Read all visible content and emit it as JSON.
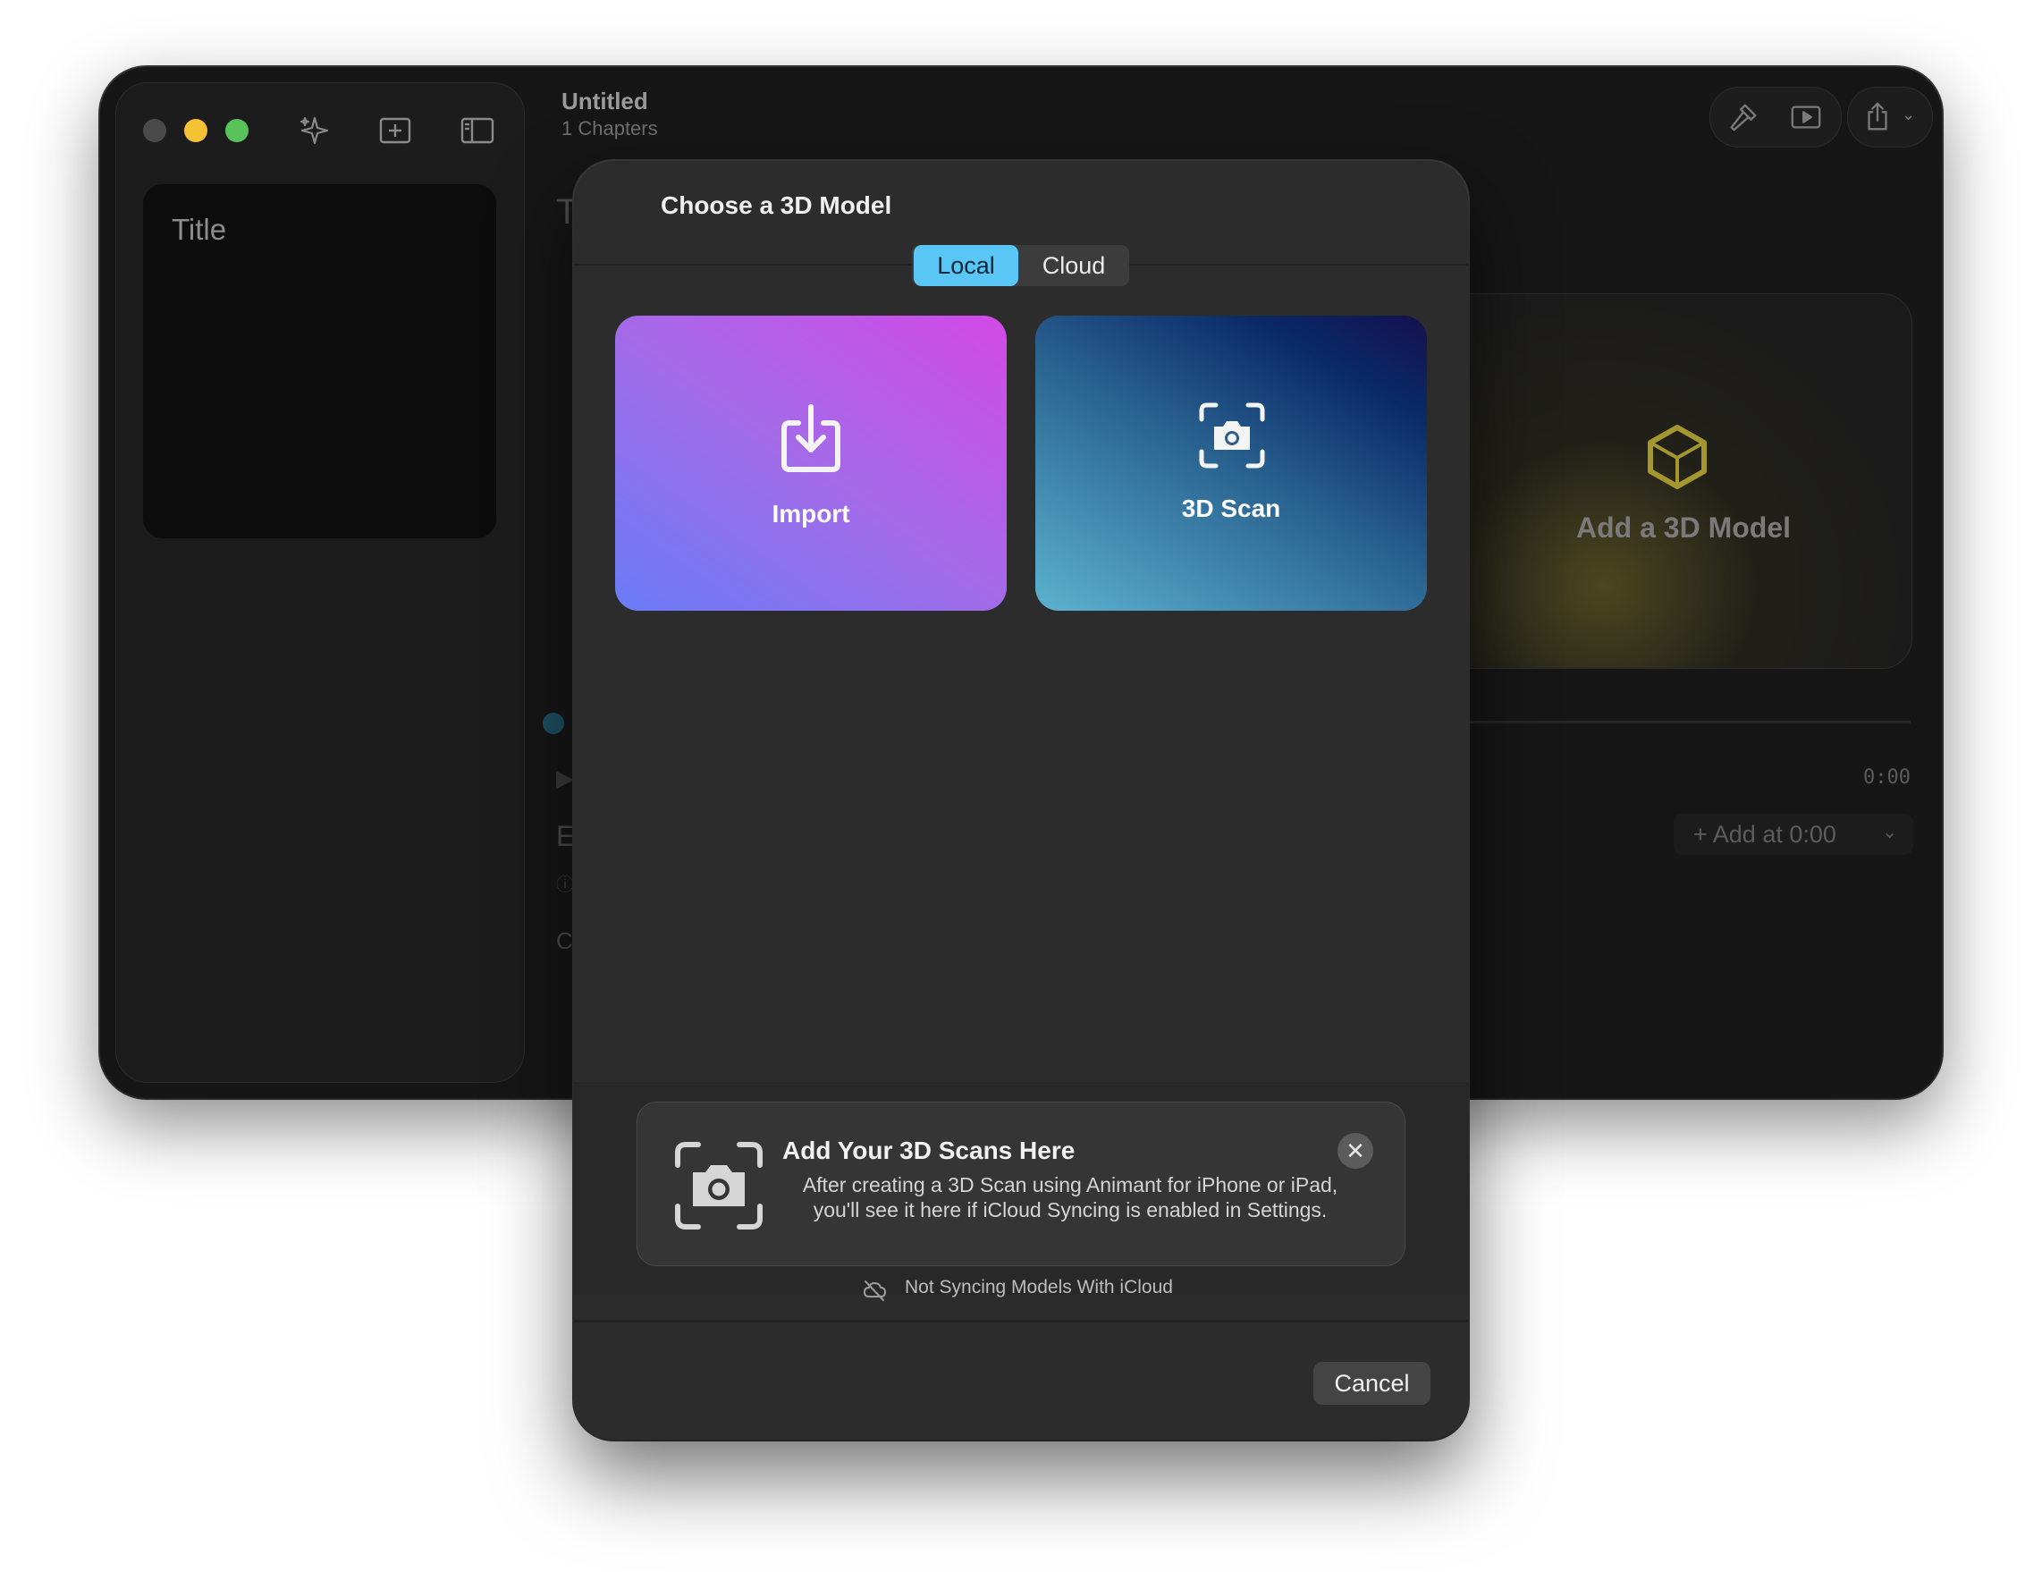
{
  "window": {
    "doc_title": "Untitled",
    "doc_subtitle": "1 Chapters",
    "sidebar_title_card": "Title",
    "bg_partial_letters": [
      "T",
      "E",
      "C"
    ],
    "add_model_card_label": "Add a 3D Model",
    "timeline_time": "0:00",
    "add_at_button": "+ Add at 0:00",
    "add_at_chevron": "⌄"
  },
  "modal": {
    "title": "Choose a 3D Model",
    "tabs": [
      {
        "label": "Local",
        "selected": true
      },
      {
        "label": "Cloud",
        "selected": false
      }
    ],
    "tiles": [
      {
        "label": "Import",
        "icon": "download-tray-icon"
      },
      {
        "label": "3D Scan",
        "icon": "camera-scan-icon"
      }
    ],
    "info_box": {
      "title": "Add Your 3D Scans Here",
      "text": "After creating a 3D Scan using Animant for iPhone or iPad, you'll see it here if iCloud Syncing is enabled in Settings.",
      "close_symbol": "✕"
    },
    "sync_status": "Not Syncing Models With iCloud",
    "cancel_label": "Cancel"
  },
  "colors": {
    "accent_tab": "#5ac6f6",
    "traffic_min": "#f5c233",
    "traffic_max": "#57c35a",
    "cube_icon": "#a4972e"
  }
}
